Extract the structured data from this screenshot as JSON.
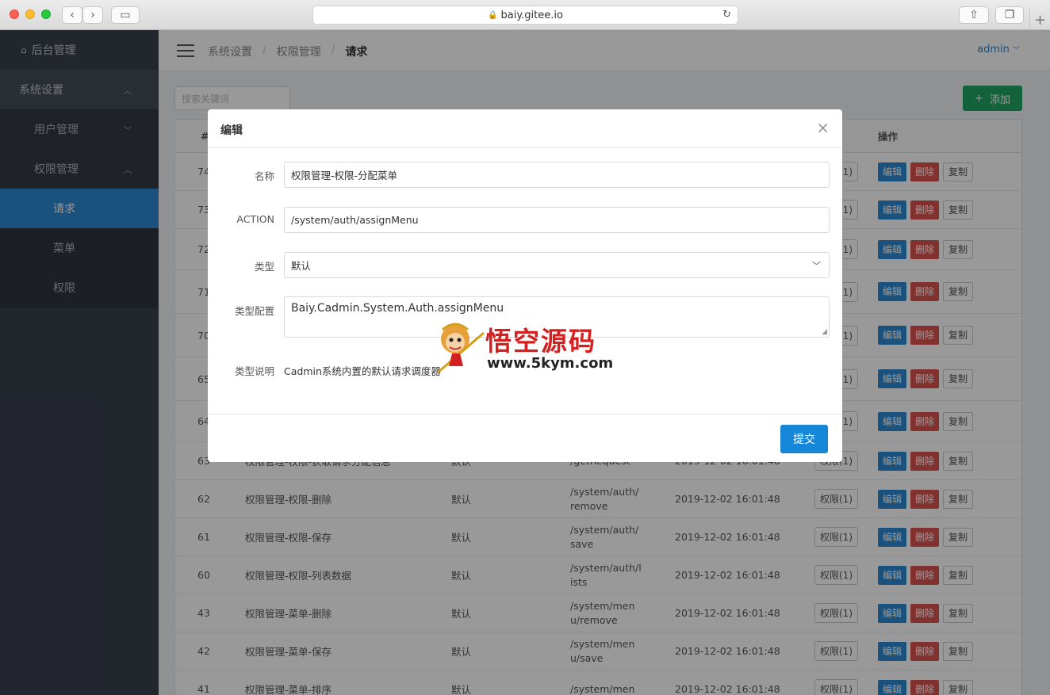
{
  "browser": {
    "url": "baiy.gitee.io"
  },
  "sidebar": {
    "home": "后台管理",
    "system": "系统设置",
    "user_mgmt": "用户管理",
    "auth_mgmt": "权限管理",
    "items": [
      {
        "label": "请求",
        "active": true
      },
      {
        "label": "菜单",
        "active": false
      },
      {
        "label": "权限",
        "active": false
      }
    ]
  },
  "header": {
    "breadcrumb": [
      "系统设置",
      "权限管理",
      "请求"
    ],
    "user": "admin"
  },
  "toolbar": {
    "search_placeholder": "搜索关键词",
    "add_label": "添加",
    "add_icon": "+"
  },
  "table": {
    "headers": {
      "id": "#",
      "ops": "操作"
    },
    "auth_label": "权限(1)",
    "edit_label": "编辑",
    "delete_label": "删除",
    "copy_label": "复制",
    "hidden_ids": [
      "74",
      "73",
      "72",
      "71",
      "70",
      "65",
      "64"
    ],
    "rows": [
      {
        "id": "63",
        "name": "权限管理-权限-获取请求分配信息",
        "type": "默认",
        "action": "/getRequest",
        "time": "2019-12-02 16:01:48"
      },
      {
        "id": "62",
        "name": "权限管理-权限-删除",
        "type": "默认",
        "action": "/system/auth/remove",
        "time": "2019-12-02 16:01:48"
      },
      {
        "id": "61",
        "name": "权限管理-权限-保存",
        "type": "默认",
        "action": "/system/auth/save",
        "time": "2019-12-02 16:01:48"
      },
      {
        "id": "60",
        "name": "权限管理-权限-列表数据",
        "type": "默认",
        "action": "/system/auth/lists",
        "time": "2019-12-02 16:01:48"
      },
      {
        "id": "43",
        "name": "权限管理-菜单-删除",
        "type": "默认",
        "action": "/system/menu/remove",
        "time": "2019-12-02 16:01:48"
      },
      {
        "id": "42",
        "name": "权限管理-菜单-保存",
        "type": "默认",
        "action": "/system/menu/save",
        "time": "2019-12-02 16:01:48"
      },
      {
        "id": "41",
        "name": "权限管理-菜单-排序",
        "type": "默认",
        "action": "/system/men",
        "time": "2019-12-02 16:01:48"
      }
    ]
  },
  "modal": {
    "title": "编辑",
    "close_icon": "×",
    "fields": {
      "name_label": "名称",
      "name_value": "权限管理-权限-分配菜单",
      "action_label": "ACTION",
      "action_value": "/system/auth/assignMenu",
      "type_label": "类型",
      "type_value": "默认",
      "config_label": "类型配置",
      "config_value": "Baiy.Cadmin.System.Auth.assignMenu",
      "desc_label": "类型说明",
      "desc_value": "Cadmin系统内置的默认请求调度器"
    },
    "submit_label": "提交"
  },
  "watermark": {
    "text_cn": "悟空源码",
    "url": "www.5kym.com"
  }
}
